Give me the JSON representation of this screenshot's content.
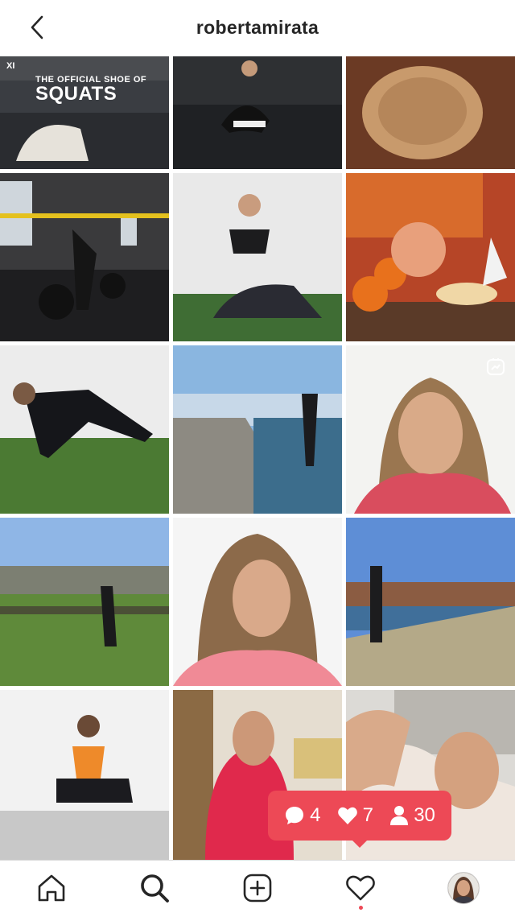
{
  "header": {
    "username": "robertamirata"
  },
  "tile_text": {
    "brand": "XI",
    "line1": "THE OFFICIAL SHOE OF",
    "line2": "SQUATS"
  },
  "activity": {
    "comments": "4",
    "likes": "7",
    "follows": "30"
  },
  "colors": {
    "accent": "#ed4956",
    "text": "#262626",
    "divider": "#dbdbdb"
  },
  "icons": {
    "back": "chevron-left-icon",
    "home": "home-icon",
    "search": "search-icon",
    "add": "plus-square-icon",
    "activity": "heart-icon",
    "profile": "avatar"
  }
}
